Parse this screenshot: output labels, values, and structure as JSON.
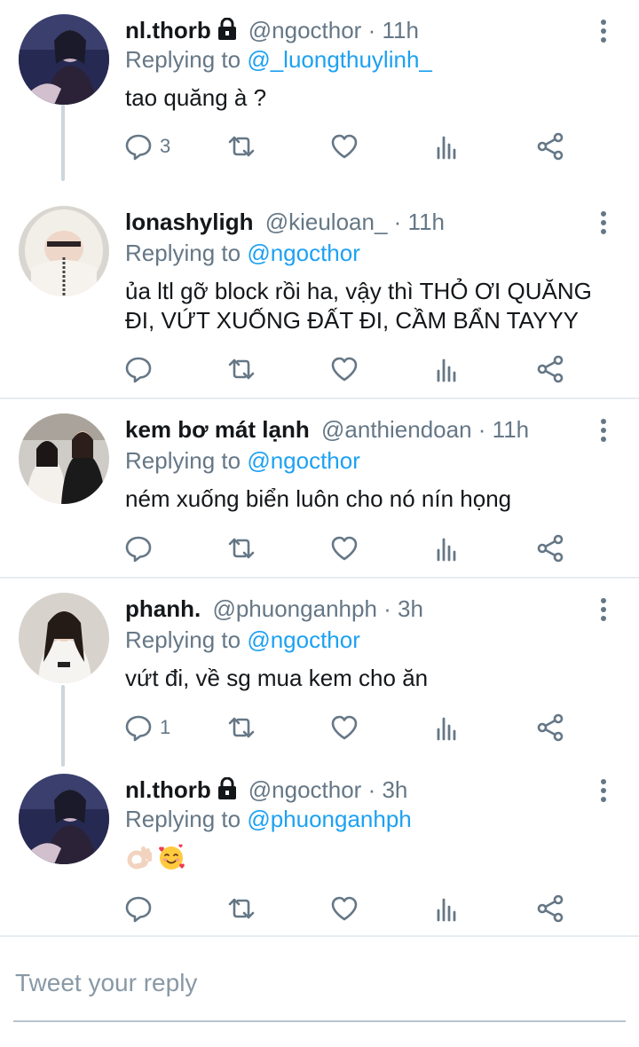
{
  "tweets": [
    {
      "name": "nl.thorb",
      "handle": "@ngocthor",
      "time": "· 11h",
      "replying_prefix": "Replying to ",
      "replying_to": "@_luongthuylinh_",
      "text": "tao quăng à ?",
      "reply_count": "3",
      "locked": true
    },
    {
      "name": "lonashyligh",
      "handle": "@kieuloan_",
      "time": "· 11h",
      "replying_prefix": "Replying to ",
      "replying_to": "@ngocthor",
      "text": "ủa ltl gỡ block rồi ha, vậy thì THỎ ƠI QUĂNG ĐI, VỨT XUỐNG ĐẤT ĐI, CẦM BẨN TAYYY",
      "reply_count": "",
      "locked": false
    },
    {
      "name": "kem bơ mát lạnh",
      "handle": "@anthiendoan",
      "time": "· 11h",
      "replying_prefix": "Replying to ",
      "replying_to": "@ngocthor",
      "text": "ném xuống biển luôn cho nó nín họng",
      "reply_count": "",
      "locked": false
    },
    {
      "name": "phanh.",
      "handle": "@phuonganhph",
      "time": "· 3h",
      "replying_prefix": "Replying to ",
      "replying_to": "@ngocthor",
      "text": "vứt đi, về sg mua kem cho ăn",
      "reply_count": "1",
      "locked": false
    },
    {
      "name": "nl.thorb",
      "handle": "@ngocthor",
      "time": "· 3h",
      "replying_prefix": "Replying to ",
      "replying_to": "@phuonganhph",
      "text": "",
      "reply_count": "",
      "locked": true,
      "emojis": [
        "ok-hand-emoji",
        "smiling-face-with-hearts-emoji"
      ]
    }
  ],
  "compose": {
    "placeholder": "Tweet your reply"
  },
  "icons": {
    "reply": "reply-icon",
    "retweet": "retweet-icon",
    "like": "heart-icon",
    "stats": "stats-icon",
    "share": "share-icon",
    "more": "more-vertical-icon",
    "lock": "lock-icon"
  },
  "colors": {
    "text": "#14171a",
    "secondary": "#657786",
    "link": "#1da1f2",
    "divider": "#e6ecf0",
    "thread_line": "#ccd6dd"
  }
}
